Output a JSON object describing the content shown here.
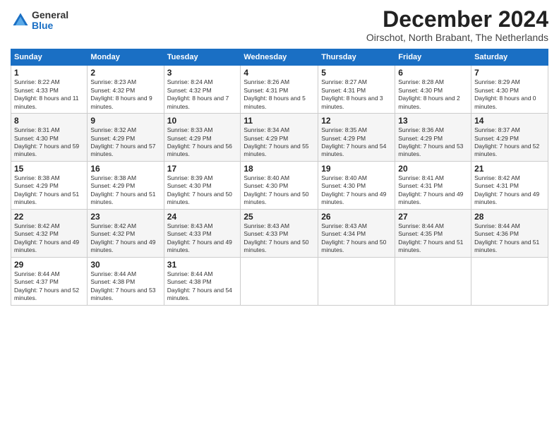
{
  "logo": {
    "general": "General",
    "blue": "Blue"
  },
  "title": "December 2024",
  "location": "Oirschot, North Brabant, The Netherlands",
  "days_of_week": [
    "Sunday",
    "Monday",
    "Tuesday",
    "Wednesday",
    "Thursday",
    "Friday",
    "Saturday"
  ],
  "weeks": [
    [
      {
        "day": "1",
        "sunrise": "8:22 AM",
        "sunset": "4:33 PM",
        "daylight": "8 hours and 11 minutes."
      },
      {
        "day": "2",
        "sunrise": "8:23 AM",
        "sunset": "4:32 PM",
        "daylight": "8 hours and 9 minutes."
      },
      {
        "day": "3",
        "sunrise": "8:24 AM",
        "sunset": "4:32 PM",
        "daylight": "8 hours and 7 minutes."
      },
      {
        "day": "4",
        "sunrise": "8:26 AM",
        "sunset": "4:31 PM",
        "daylight": "8 hours and 5 minutes."
      },
      {
        "day": "5",
        "sunrise": "8:27 AM",
        "sunset": "4:31 PM",
        "daylight": "8 hours and 3 minutes."
      },
      {
        "day": "6",
        "sunrise": "8:28 AM",
        "sunset": "4:30 PM",
        "daylight": "8 hours and 2 minutes."
      },
      {
        "day": "7",
        "sunrise": "8:29 AM",
        "sunset": "4:30 PM",
        "daylight": "8 hours and 0 minutes."
      }
    ],
    [
      {
        "day": "8",
        "sunrise": "8:31 AM",
        "sunset": "4:30 PM",
        "daylight": "7 hours and 59 minutes."
      },
      {
        "day": "9",
        "sunrise": "8:32 AM",
        "sunset": "4:29 PM",
        "daylight": "7 hours and 57 minutes."
      },
      {
        "day": "10",
        "sunrise": "8:33 AM",
        "sunset": "4:29 PM",
        "daylight": "7 hours and 56 minutes."
      },
      {
        "day": "11",
        "sunrise": "8:34 AM",
        "sunset": "4:29 PM",
        "daylight": "7 hours and 55 minutes."
      },
      {
        "day": "12",
        "sunrise": "8:35 AM",
        "sunset": "4:29 PM",
        "daylight": "7 hours and 54 minutes."
      },
      {
        "day": "13",
        "sunrise": "8:36 AM",
        "sunset": "4:29 PM",
        "daylight": "7 hours and 53 minutes."
      },
      {
        "day": "14",
        "sunrise": "8:37 AM",
        "sunset": "4:29 PM",
        "daylight": "7 hours and 52 minutes."
      }
    ],
    [
      {
        "day": "15",
        "sunrise": "8:38 AM",
        "sunset": "4:29 PM",
        "daylight": "7 hours and 51 minutes."
      },
      {
        "day": "16",
        "sunrise": "8:38 AM",
        "sunset": "4:29 PM",
        "daylight": "7 hours and 51 minutes."
      },
      {
        "day": "17",
        "sunrise": "8:39 AM",
        "sunset": "4:30 PM",
        "daylight": "7 hours and 50 minutes."
      },
      {
        "day": "18",
        "sunrise": "8:40 AM",
        "sunset": "4:30 PM",
        "daylight": "7 hours and 50 minutes."
      },
      {
        "day": "19",
        "sunrise": "8:40 AM",
        "sunset": "4:30 PM",
        "daylight": "7 hours and 49 minutes."
      },
      {
        "day": "20",
        "sunrise": "8:41 AM",
        "sunset": "4:31 PM",
        "daylight": "7 hours and 49 minutes."
      },
      {
        "day": "21",
        "sunrise": "8:42 AM",
        "sunset": "4:31 PM",
        "daylight": "7 hours and 49 minutes."
      }
    ],
    [
      {
        "day": "22",
        "sunrise": "8:42 AM",
        "sunset": "4:32 PM",
        "daylight": "7 hours and 49 minutes."
      },
      {
        "day": "23",
        "sunrise": "8:42 AM",
        "sunset": "4:32 PM",
        "daylight": "7 hours and 49 minutes."
      },
      {
        "day": "24",
        "sunrise": "8:43 AM",
        "sunset": "4:33 PM",
        "daylight": "7 hours and 49 minutes."
      },
      {
        "day": "25",
        "sunrise": "8:43 AM",
        "sunset": "4:33 PM",
        "daylight": "7 hours and 50 minutes."
      },
      {
        "day": "26",
        "sunrise": "8:43 AM",
        "sunset": "4:34 PM",
        "daylight": "7 hours and 50 minutes."
      },
      {
        "day": "27",
        "sunrise": "8:44 AM",
        "sunset": "4:35 PM",
        "daylight": "7 hours and 51 minutes."
      },
      {
        "day": "28",
        "sunrise": "8:44 AM",
        "sunset": "4:36 PM",
        "daylight": "7 hours and 51 minutes."
      }
    ],
    [
      {
        "day": "29",
        "sunrise": "8:44 AM",
        "sunset": "4:37 PM",
        "daylight": "7 hours and 52 minutes."
      },
      {
        "day": "30",
        "sunrise": "8:44 AM",
        "sunset": "4:38 PM",
        "daylight": "7 hours and 53 minutes."
      },
      {
        "day": "31",
        "sunrise": "8:44 AM",
        "sunset": "4:38 PM",
        "daylight": "7 hours and 54 minutes."
      },
      null,
      null,
      null,
      null
    ]
  ],
  "labels": {
    "sunrise": "Sunrise:",
    "sunset": "Sunset:",
    "daylight": "Daylight:"
  }
}
